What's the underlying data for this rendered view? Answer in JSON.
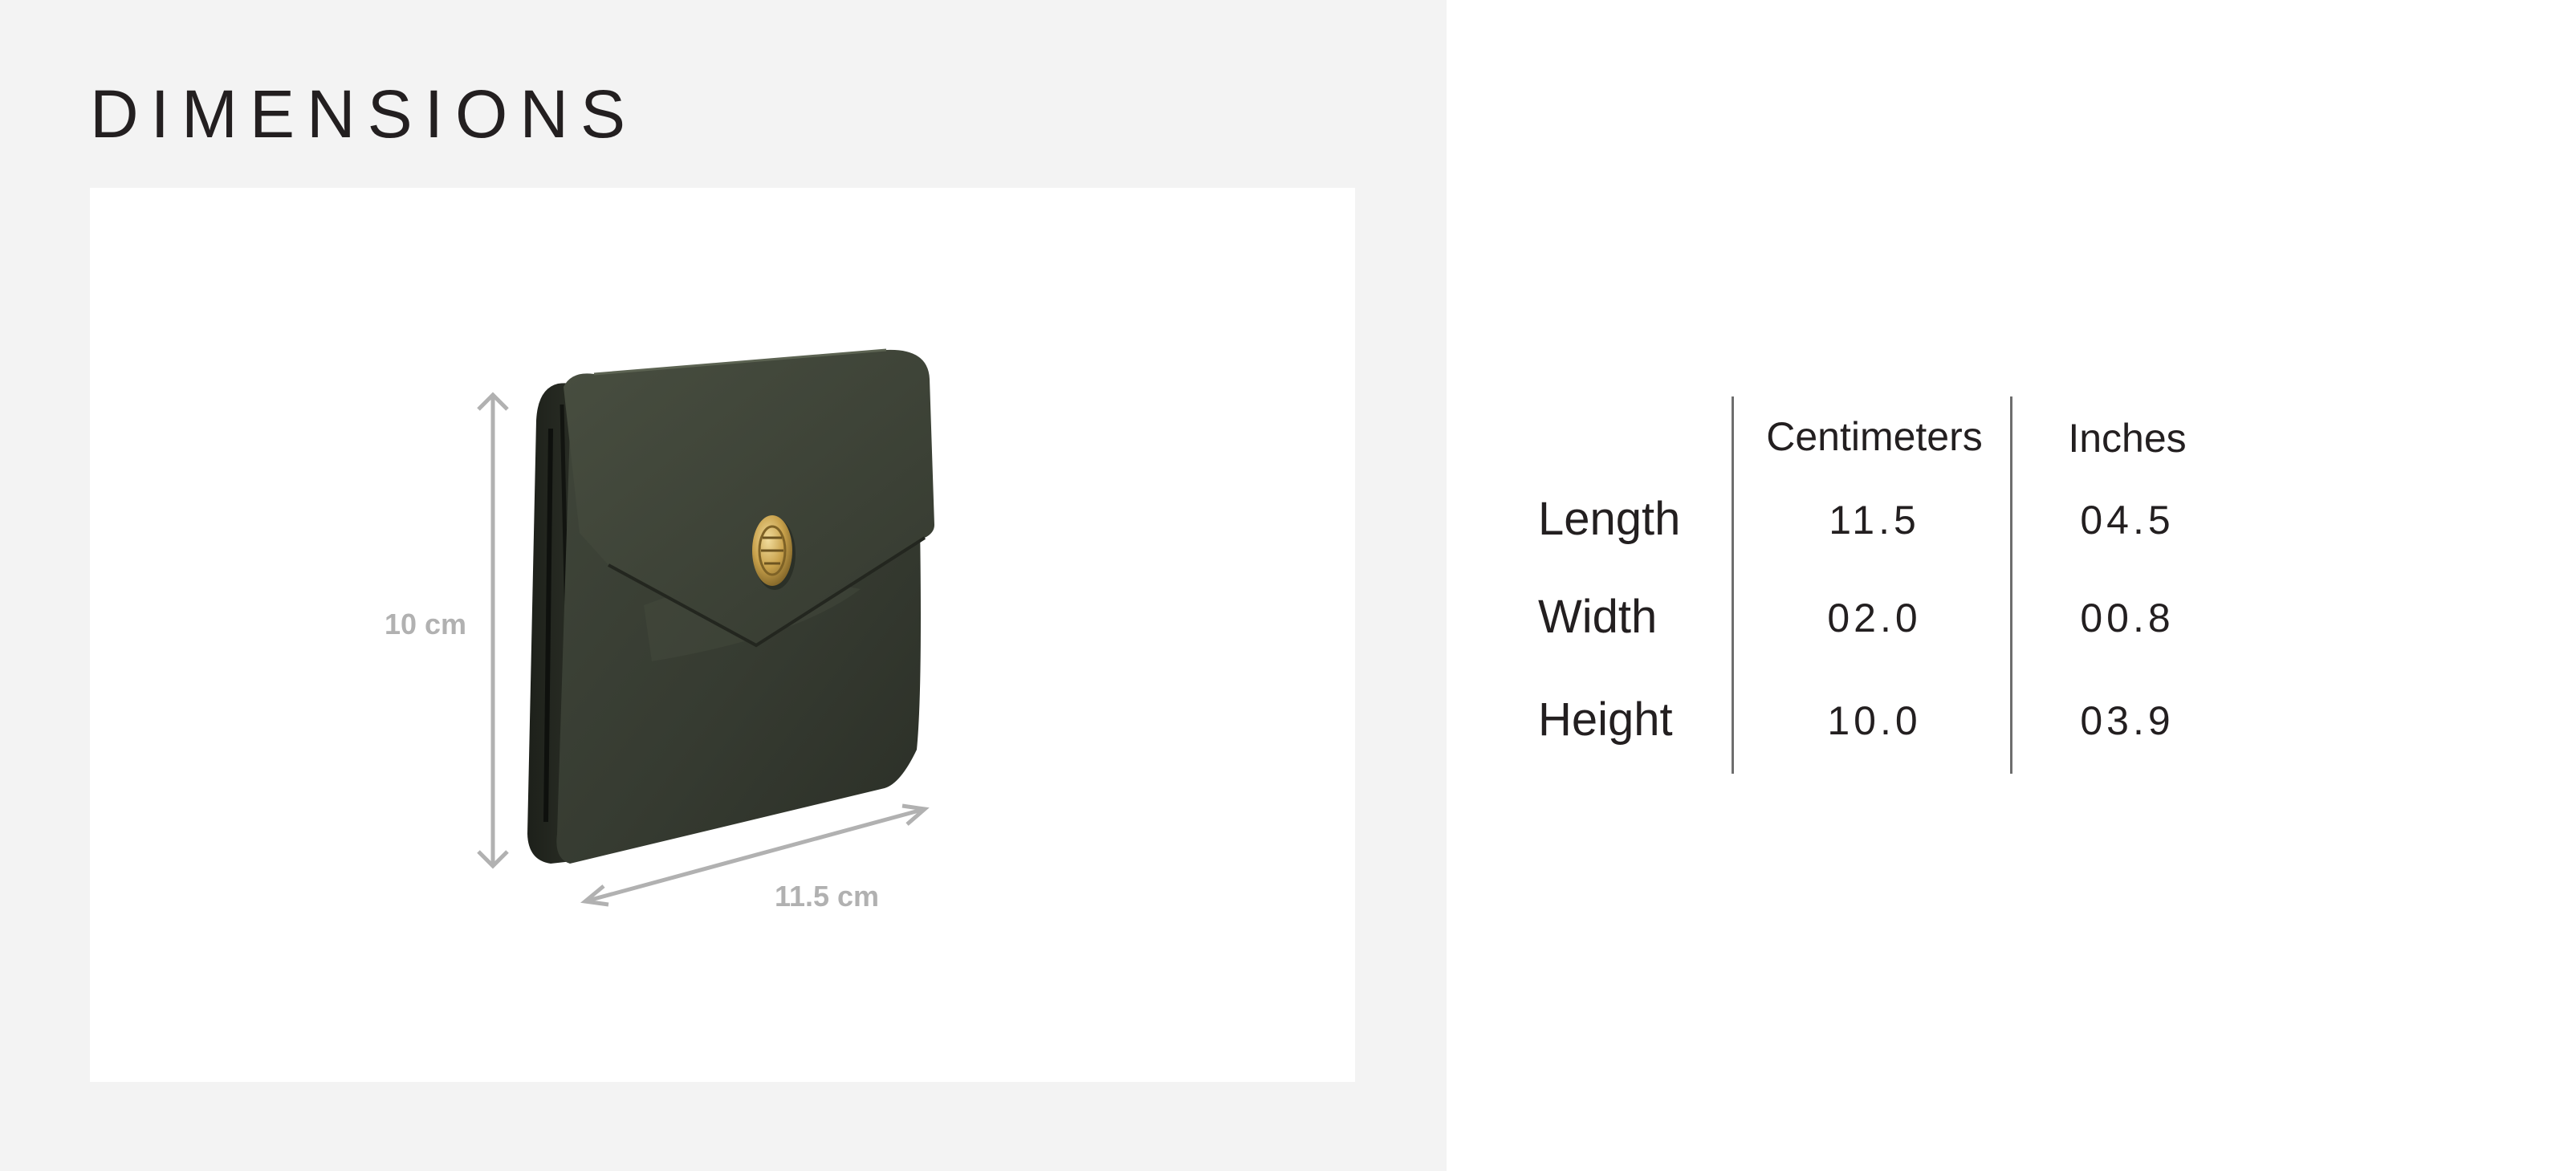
{
  "title": "DIMENSIONS",
  "figure": {
    "height_label": "10 cm",
    "length_label": "11.5 cm",
    "product": "dark green leather wallet with gold snap button"
  },
  "table": {
    "headers": {
      "cm": "Centimeters",
      "in": "Inches"
    },
    "rows": [
      {
        "label": "Length",
        "cm": "11.5",
        "in": "04.5"
      },
      {
        "label": "Width",
        "cm": "02.0",
        "in": "00.8"
      },
      {
        "label": "Height",
        "cm": "10.0",
        "in": "03.9"
      }
    ]
  },
  "colors": {
    "panel_bg": "#f3f3f3",
    "text": "#231f20",
    "arrow": "#b1b1b1",
    "leather": "#3b3f34",
    "snap": "#c9a24c"
  }
}
